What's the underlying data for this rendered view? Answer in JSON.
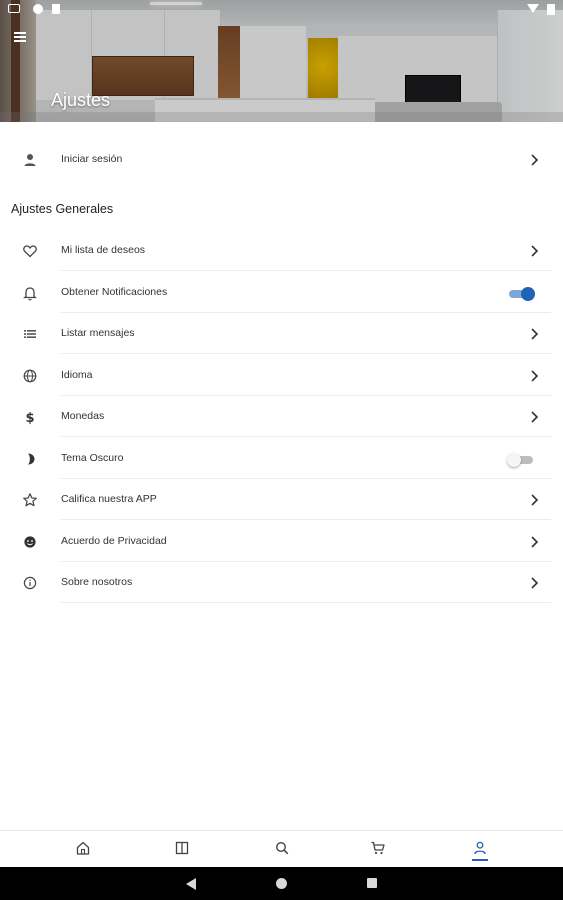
{
  "header": {
    "title": "Ajustes"
  },
  "account": {
    "login_label": "Iniciar sesión"
  },
  "general": {
    "section_title": "Ajustes Generales",
    "items": [
      {
        "label": "Mi lista de deseos",
        "icon": "heart-icon"
      },
      {
        "label": "Obtener Notificaciones",
        "icon": "bell-icon",
        "toggle": true
      },
      {
        "label": "Listar mensajes",
        "icon": "list-icon"
      },
      {
        "label": "Idioma",
        "icon": "globe-icon"
      },
      {
        "label": "Monedas",
        "icon": "dollar-icon"
      },
      {
        "label": "Tema Oscuro",
        "icon": "moon-icon",
        "toggle": false
      },
      {
        "label": "Califica nuestra APP",
        "icon": "star-icon"
      },
      {
        "label": "Acuerdo de Privacidad",
        "icon": "privacy-icon"
      },
      {
        "label": "Sobre nosotros",
        "icon": "info-icon"
      }
    ]
  },
  "bottom_nav": {
    "items": [
      "home-icon",
      "catalog-icon",
      "search-icon",
      "cart-icon",
      "profile-icon"
    ],
    "active": "profile-icon"
  },
  "colors": {
    "accent": "#1e63b6",
    "toggle_track_on": "#7ea6d6",
    "divider": "#ececec"
  }
}
